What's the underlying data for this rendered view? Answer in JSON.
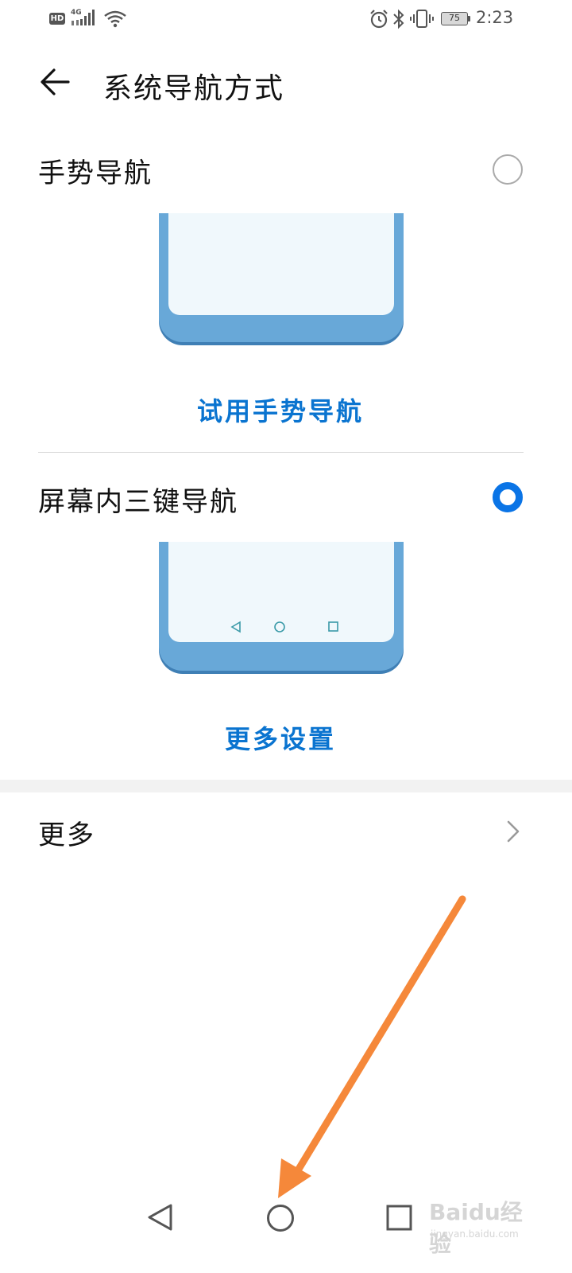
{
  "status_bar": {
    "hd_badge": "HD",
    "network_type": "4G",
    "battery_level": "75",
    "time": "2:23",
    "icons": [
      "hd-icon",
      "signal-icon",
      "wifi-icon",
      "alarm-icon",
      "bluetooth-icon",
      "vibrate-icon",
      "battery-icon"
    ]
  },
  "header": {
    "back_icon": "arrow-left-icon",
    "title": "系统导航方式"
  },
  "options": [
    {
      "title": "手势导航",
      "selected": false,
      "action_label": "试用手势导航"
    },
    {
      "title": "屏幕内三键导航",
      "selected": true,
      "action_label": "更多设置"
    }
  ],
  "more": {
    "label": "更多",
    "icon": "chevron-right-icon"
  },
  "nav_bar": {
    "buttons": [
      "back-triangle-icon",
      "home-circle-icon",
      "recents-square-icon"
    ]
  },
  "annotation": {
    "arrow_color": "#f5883a"
  },
  "watermark": {
    "text": "Baidu经验",
    "url": "jingyan.baidu.com"
  },
  "colors": {
    "accent": "#0a74e6",
    "link": "#0a74d0",
    "illustration": "#68a8d8"
  }
}
